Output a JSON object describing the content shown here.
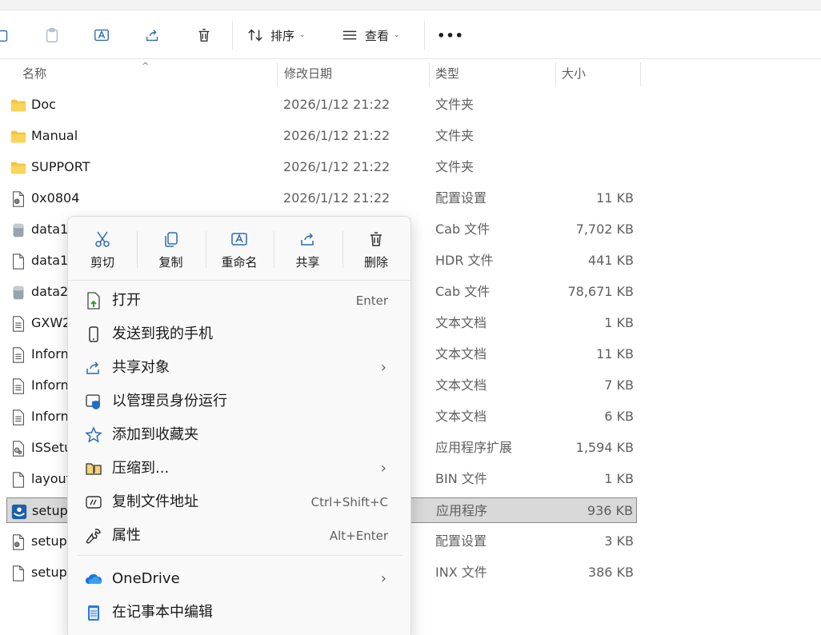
{
  "toolbar": {
    "sort_label": "排序",
    "view_label": "查看",
    "more_label": "•••",
    "chevron": "⌄"
  },
  "columns": {
    "name": "名称",
    "date": "修改日期",
    "type": "类型",
    "size": "大小",
    "sort_caret": "^"
  },
  "files": [
    {
      "name": "Doc",
      "date": "2026/1/12 21:22",
      "type": "文件夹",
      "size": "",
      "icon": "folder-icon"
    },
    {
      "name": "Manual",
      "date": "2026/1/12 21:22",
      "type": "文件夹",
      "size": "",
      "icon": "folder-icon"
    },
    {
      "name": "SUPPORT",
      "date": "2026/1/12 21:22",
      "type": "文件夹",
      "size": "",
      "icon": "folder-icon"
    },
    {
      "name": "0x0804",
      "date": "2026/1/12 21:22",
      "type": "配置设置",
      "size": "11 KB",
      "icon": "config-file-icon"
    },
    {
      "name": "data1",
      "date": "",
      "type": "Cab 文件",
      "size": "7,702 KB",
      "icon": "cab-file-icon"
    },
    {
      "name": "data1",
      "date": "",
      "type": "HDR 文件",
      "size": "441 KB",
      "icon": "blank-file-icon"
    },
    {
      "name": "data2",
      "date": "",
      "type": "Cab 文件",
      "size": "78,671 KB",
      "icon": "cab-file-icon"
    },
    {
      "name": "GXW2",
      "date": "",
      "type": "文本文档",
      "size": "1 KB",
      "icon": "text-file-icon"
    },
    {
      "name": "Inforn",
      "date": "",
      "type": "文本文档",
      "size": "11 KB",
      "icon": "text-file-icon"
    },
    {
      "name": "Inforn",
      "date": "",
      "type": "文本文档",
      "size": "7 KB",
      "icon": "text-file-icon"
    },
    {
      "name": "Inforn",
      "date": "",
      "type": "文本文档",
      "size": "6 KB",
      "icon": "text-file-icon"
    },
    {
      "name": "ISSetu",
      "date": "",
      "type": "应用程序扩展",
      "size": "1,594 KB",
      "icon": "dll-file-icon"
    },
    {
      "name": "layout",
      "date": "",
      "type": "BIN 文件",
      "size": "1 KB",
      "icon": "blank-file-icon"
    },
    {
      "name": "setup",
      "date": "",
      "type": "应用程序",
      "size": "936 KB",
      "icon": "setup-exe-icon",
      "selected": true
    },
    {
      "name": "setup",
      "date": "",
      "type": "配置设置",
      "size": "3 KB",
      "icon": "config-file-icon"
    },
    {
      "name": "setup",
      "date": "",
      "type": "INX 文件",
      "size": "386 KB",
      "icon": "blank-file-icon"
    }
  ],
  "context_menu": {
    "quick_actions": [
      {
        "label": "剪切",
        "icon": "scissors-icon"
      },
      {
        "label": "复制",
        "icon": "copy-icon"
      },
      {
        "label": "重命名",
        "icon": "rename-icon"
      },
      {
        "label": "共享",
        "icon": "share-icon"
      },
      {
        "label": "删除",
        "icon": "trash-icon"
      }
    ],
    "items": [
      {
        "label": "打开",
        "shortcut": "Enter",
        "arrow": "",
        "icon": "open-icon"
      },
      {
        "label": "发送到我的手机",
        "shortcut": "",
        "arrow": "",
        "icon": "phone-icon"
      },
      {
        "label": "共享对象",
        "shortcut": "",
        "arrow": "›",
        "icon": "share-icon"
      },
      {
        "label": "以管理员身份运行",
        "shortcut": "",
        "arrow": "",
        "icon": "admin-shield-icon"
      },
      {
        "label": "添加到收藏夹",
        "shortcut": "",
        "arrow": "",
        "icon": "star-icon"
      },
      {
        "label": "压缩到...",
        "shortcut": "",
        "arrow": "›",
        "icon": "zip-icon"
      },
      {
        "label": "复制文件地址",
        "shortcut": "Ctrl+Shift+C",
        "arrow": "",
        "icon": "copy-path-icon"
      },
      {
        "label": "属性",
        "shortcut": "Alt+Enter",
        "arrow": "",
        "icon": "wrench-icon"
      },
      {
        "label": "OneDrive",
        "shortcut": "",
        "arrow": "›",
        "icon": "onedrive-cloud-icon"
      },
      {
        "label": "在记事本中编辑",
        "shortcut": "",
        "arrow": "",
        "icon": "notepad-icon"
      }
    ]
  },
  "colors": {
    "accent": "#0067c0",
    "folder": "#f4c542",
    "selection": "#d9d9d9"
  }
}
